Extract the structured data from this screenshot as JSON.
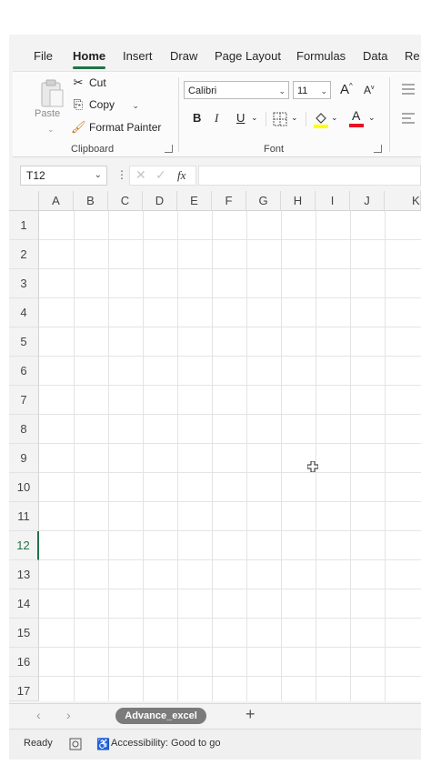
{
  "ribbon_tabs": [
    "File",
    "Home",
    "Insert",
    "Draw",
    "Page Layout",
    "Formulas",
    "Data",
    "Re"
  ],
  "active_tab": "Home",
  "clipboard": {
    "paste": "Paste",
    "cut": "Cut",
    "copy": "Copy",
    "format_painter": "Format Painter",
    "group_label": "Clipboard"
  },
  "font": {
    "name": "Calibri",
    "size": "11",
    "grow": "A",
    "shrink": "A",
    "bold": "B",
    "italic": "I",
    "underline": "U",
    "font_color_letter": "A",
    "group_label": "Font"
  },
  "formula_bar": {
    "name_box": "T12",
    "fx": "fx",
    "value": ""
  },
  "columns": [
    "A",
    "B",
    "C",
    "D",
    "E",
    "F",
    "G",
    "H",
    "I",
    "J",
    "K"
  ],
  "rows": [
    "1",
    "2",
    "3",
    "4",
    "5",
    "6",
    "7",
    "8",
    "9",
    "10",
    "11",
    "12",
    "13",
    "14",
    "15",
    "16",
    "17"
  ],
  "active_row": "12",
  "sheet": {
    "tab_name": "Advance_excel",
    "add": "+"
  },
  "status": {
    "ready": "Ready",
    "accessibility": "Accessibility: Good to go"
  },
  "colors": {
    "accent": "#217346",
    "highlight": "#ffff00",
    "font_color": "#e81123"
  }
}
